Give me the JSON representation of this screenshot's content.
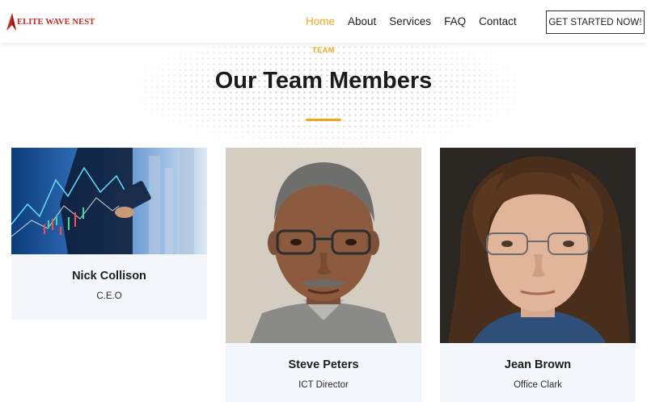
{
  "brand": {
    "name": "ELITE WAVE NEST",
    "color": "#c9261b"
  },
  "nav": {
    "items": [
      {
        "label": "Home",
        "active": true
      },
      {
        "label": "About",
        "active": false
      },
      {
        "label": "Services",
        "active": false
      },
      {
        "label": "FAQ",
        "active": false
      },
      {
        "label": "Contact",
        "active": false
      }
    ],
    "cta_label": "GET STARTED NOW!"
  },
  "section": {
    "eyebrow": "TEAM",
    "title": "Our Team Members",
    "accent_color": "#f0a818"
  },
  "team": [
    {
      "name": "Nick Collison",
      "role": "C.E.O",
      "photo": "business-chart-photo"
    },
    {
      "name": "Steve Peters",
      "role": "ICT Director",
      "photo": "man-portrait-photo"
    },
    {
      "name": "Jean Brown",
      "role": "Office Clark",
      "photo": "woman-portrait-photo"
    }
  ]
}
